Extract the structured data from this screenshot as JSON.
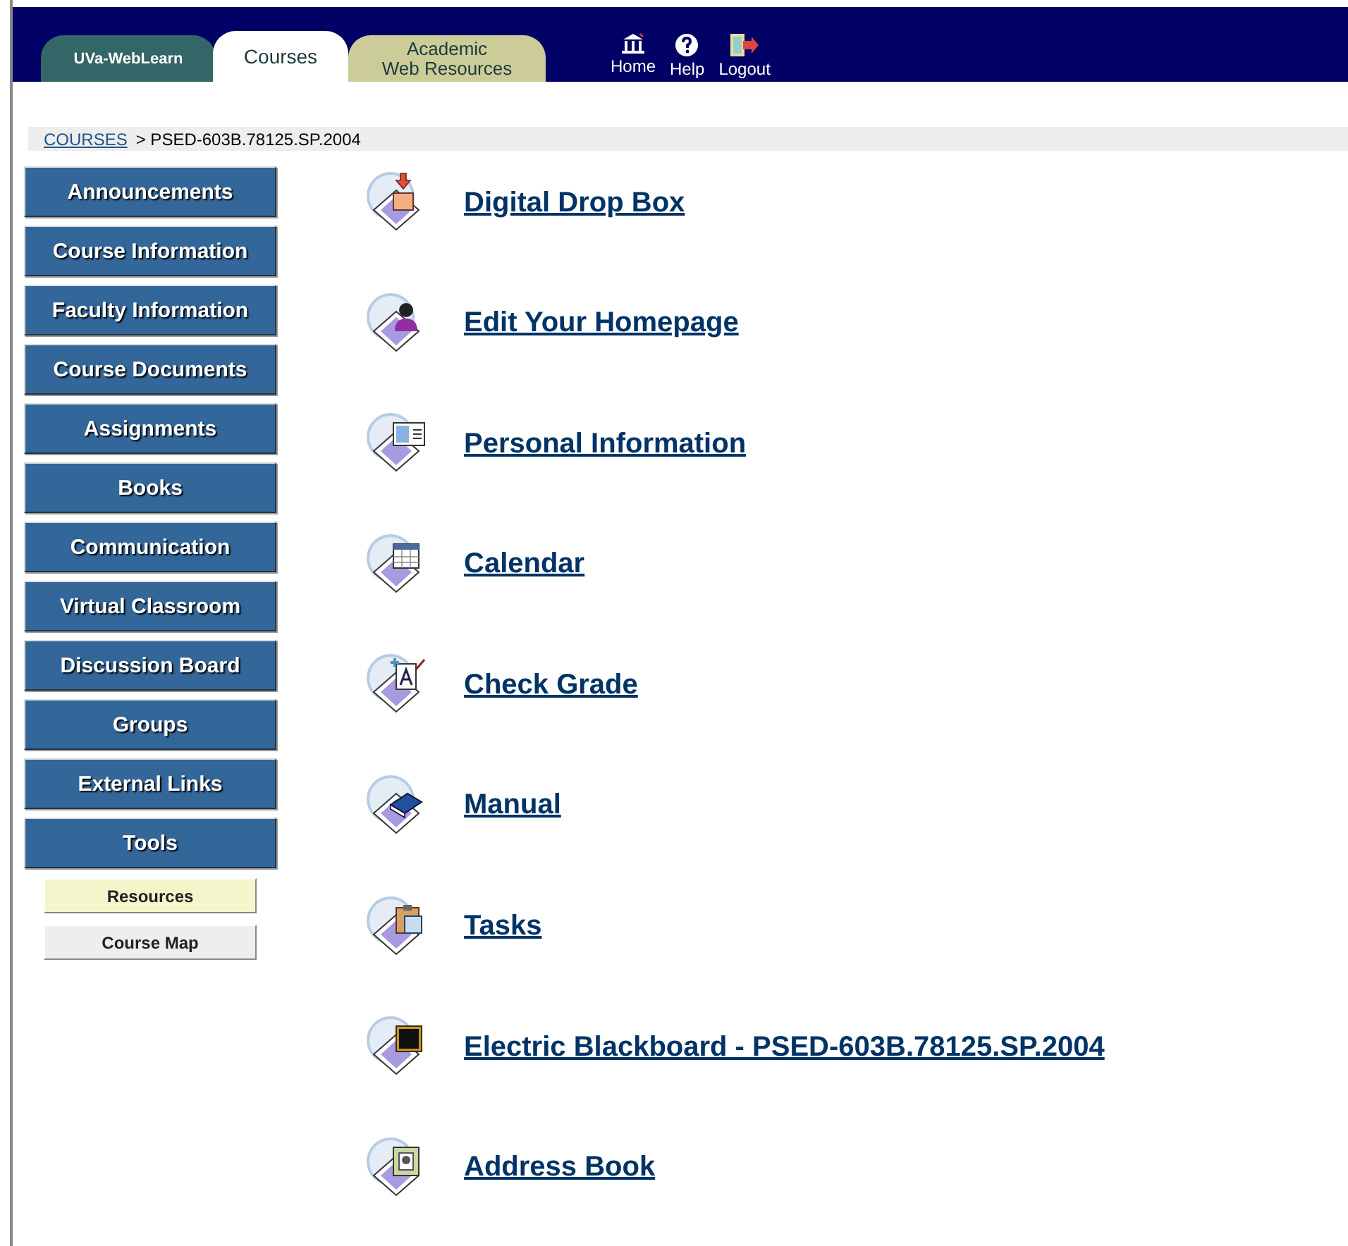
{
  "header": {
    "tabs": [
      {
        "label": "UVa-WebLearn",
        "selected": false,
        "kind": "teal"
      },
      {
        "label": "Courses",
        "selected": true,
        "kind": "white"
      },
      {
        "label": "Academic\nWeb Resources",
        "selected": false,
        "kind": "khaki"
      }
    ],
    "actions": [
      {
        "label": "Home",
        "kind": "home"
      },
      {
        "label": "Help",
        "kind": "help"
      },
      {
        "label": "Logout",
        "kind": "logout"
      }
    ]
  },
  "breadcrumb": {
    "link": "COURSES",
    "current": "> PSED-603B.78125.SP.2004"
  },
  "sidebar": {
    "items": [
      {
        "label": "Announcements"
      },
      {
        "label": "Course Information"
      },
      {
        "label": "Faculty Information"
      },
      {
        "label": "Course Documents"
      },
      {
        "label": "Assignments"
      },
      {
        "label": "Books"
      },
      {
        "label": "Communication"
      },
      {
        "label": "Virtual Classroom"
      },
      {
        "label": "Discussion Board"
      },
      {
        "label": "Groups"
      },
      {
        "label": "External Links"
      },
      {
        "label": "Tools",
        "children": [
          {
            "label": "Resources",
            "selected": true
          },
          {
            "label": "Course Map",
            "selected": false
          }
        ]
      }
    ]
  },
  "tools": [
    {
      "label": "Digital Drop Box",
      "kind": "box"
    },
    {
      "label": "Edit Your Homepage",
      "kind": "person"
    },
    {
      "label": "Personal Information",
      "kind": "card"
    },
    {
      "label": "Calendar",
      "kind": "calendar"
    },
    {
      "label": "Check Grade",
      "kind": "grade"
    },
    {
      "label": "Manual",
      "kind": "book"
    },
    {
      "label": "Tasks",
      "kind": "clipboard"
    },
    {
      "label": "Electric Blackboard - PSED-603B.78125.SP.2004",
      "kind": "board"
    },
    {
      "label": "Address Book",
      "kind": "address"
    }
  ]
}
